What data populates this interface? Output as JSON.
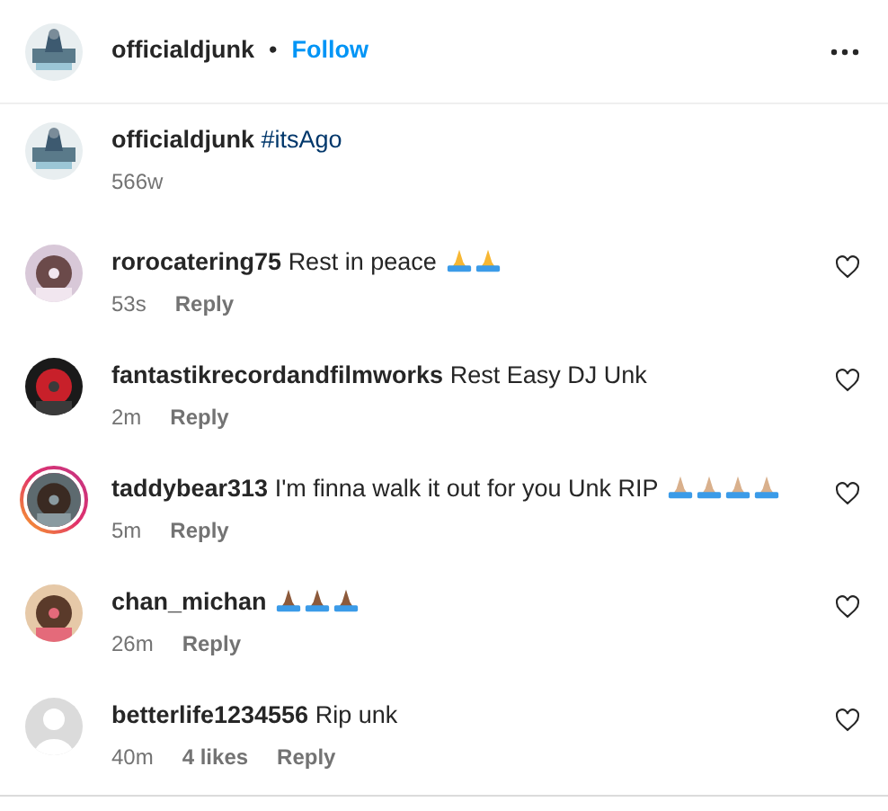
{
  "header": {
    "username": "officialdjunk",
    "separator": "•",
    "follow": "Follow"
  },
  "caption": {
    "username": "officialdjunk",
    "text": "#itsAgo",
    "time": "566w"
  },
  "comments": [
    {
      "username": "rorocatering75",
      "text": "Rest in peace",
      "emoji": [
        {
          "color": "#f7b733"
        },
        {
          "color": "#f7b733"
        }
      ],
      "time": "53s",
      "reply": "Reply"
    },
    {
      "username": "fantastikrecordandfilmworks",
      "text": "Rest Easy DJ Unk",
      "time": "2m",
      "reply": "Reply"
    },
    {
      "story_ring": true,
      "username": "taddybear313",
      "text": "I'm finna walk it out for you Unk RIP",
      "emoji": [
        {
          "color": "#d9b08c"
        },
        {
          "color": "#d9b08c"
        },
        {
          "color": "#d9b08c"
        },
        {
          "color": "#d9b08c"
        }
      ],
      "time": "5m",
      "reply": "Reply"
    },
    {
      "username": "chan_michan",
      "emoji": [
        {
          "color": "#8d5a3b"
        },
        {
          "color": "#8d5a3b"
        },
        {
          "color": "#8d5a3b"
        }
      ],
      "time": "26m",
      "reply": "Reply"
    },
    {
      "default_avatar": true,
      "username": "betterlife1234556",
      "text": "Rip unk",
      "time": "40m",
      "likes": "4 likes",
      "reply": "Reply"
    }
  ]
}
